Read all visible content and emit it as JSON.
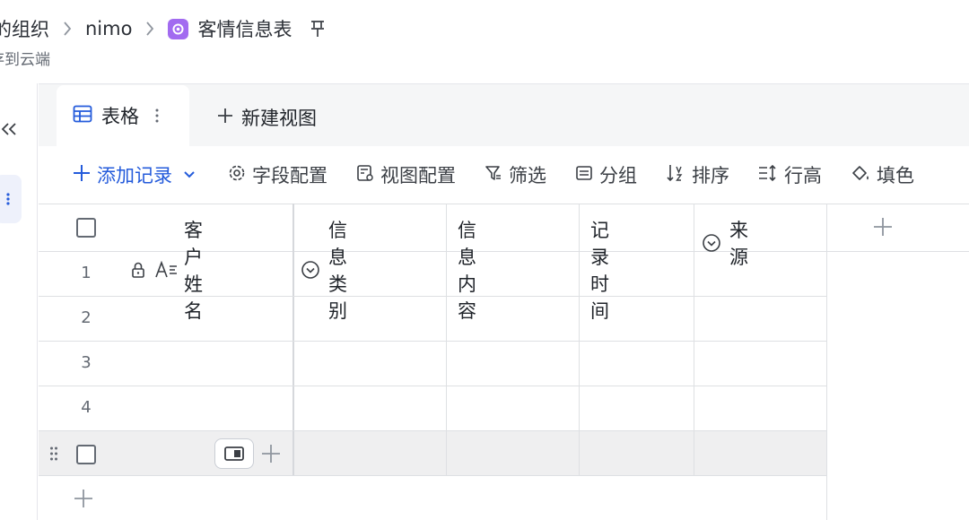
{
  "breadcrumb": {
    "org": "的组织",
    "workspace": "nimo",
    "document": "客情信息表"
  },
  "subline": "存到云端",
  "view_tabs": {
    "active_label": "表格",
    "new_view_label": "新建视图"
  },
  "toolbar": {
    "add_record": "添加记录",
    "field_config": "字段配置",
    "view_config": "视图配置",
    "filter": "筛选",
    "group": "分组",
    "sort": "排序",
    "row_height": "行高",
    "fill": "填色"
  },
  "table": {
    "columns": [
      {
        "label": "客户姓名",
        "icon": "text-field-icon",
        "primary": true,
        "locked": true
      },
      {
        "label": "信息类别",
        "icon": "single-select-icon"
      },
      {
        "label": "信息内容",
        "icon": ""
      },
      {
        "label": "记录时间",
        "icon": ""
      },
      {
        "label": "来源",
        "icon": "single-select-icon"
      }
    ],
    "rows": [
      "1",
      "2",
      "3",
      "4"
    ]
  },
  "colors": {
    "accent": "#245bdb",
    "doc_icon": "#a26bf0",
    "grid_line": "#dee0e3",
    "hover_row": "#efeff0"
  }
}
